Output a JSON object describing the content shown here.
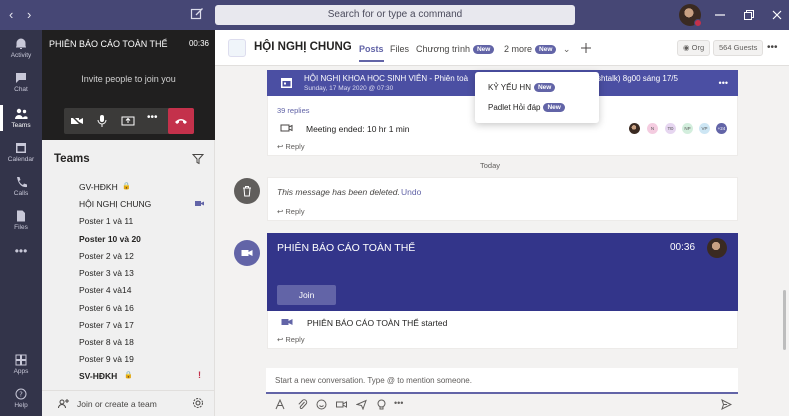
{
  "titlebar": {
    "search_placeholder": "Search for or type a command",
    "back": "‹",
    "forward": "›"
  },
  "rail": [
    {
      "label": "Activity",
      "icon": "bell-icon"
    },
    {
      "label": "Chat",
      "icon": "chat-icon"
    },
    {
      "label": "Teams",
      "icon": "teams-icon",
      "active": true
    },
    {
      "label": "Calendar",
      "icon": "calendar-icon"
    },
    {
      "label": "Calls",
      "icon": "phone-icon"
    },
    {
      "label": "Files",
      "icon": "file-icon"
    },
    {
      "label": "Apps",
      "icon": "apps-icon"
    },
    {
      "label": "Help",
      "icon": "help-icon"
    }
  ],
  "meeting": {
    "title": "PHIÊN BÁO CÁO TOÀN THỂ",
    "time": "00:36",
    "invite": "Invite people to join you"
  },
  "teams": {
    "heading": "Teams",
    "channels": [
      {
        "name": "GV-HĐKH",
        "lock": true
      },
      {
        "name": "HỘI NGHỊ CHUNG",
        "live": true
      },
      {
        "name": "Poster 1 và 11"
      },
      {
        "name": "Poster 10 và 20",
        "bold": true
      },
      {
        "name": "Poster 2 và 12"
      },
      {
        "name": "Poster 3 và 13"
      },
      {
        "name": "Poster 4 và14"
      },
      {
        "name": "Poster 6 và 16"
      },
      {
        "name": "Poster 7 và 17"
      },
      {
        "name": "Poster 8 và 18"
      },
      {
        "name": "Poster 9 và 19"
      },
      {
        "name": "SV-HĐKH",
        "bold": true,
        "lock": true,
        "alert": "!"
      }
    ],
    "join_label": "Join or create a team"
  },
  "header": {
    "team_name": "HỘI NGHỊ CHUNG",
    "tabs": [
      "Posts",
      "Files",
      "Chương trình",
      "2 more"
    ],
    "badge_new": "New",
    "org": "Org",
    "guests": "564 Guests"
  },
  "dropdown": {
    "items": [
      "KỶ YẾU HN",
      "Padlet Hỏi đáp"
    ]
  },
  "conversation": {
    "meeting_title": "HỘI NGHỊ KHOA HỌC SINH VIÊN - Phiên toà",
    "meeting_title_tail": "shtalk) 8g00 sáng 17/5",
    "meeting_date": "Sunday, 17 May 2020 @ 07:30",
    "replies": "39 replies",
    "meeting_ended": "Meeting ended: 10 hr 1 min",
    "participants": [
      "N",
      "TĐ",
      "NP",
      "VP"
    ],
    "participants_more": "+24",
    "reply": "Reply",
    "today": "Today",
    "deleted": "This message has been deleted.",
    "undo": "Undo",
    "live_title": "PHIÊN BÁO CÁO TOÀN THỂ",
    "live_time": "00:36",
    "join": "Join",
    "started": "PHIÊN BÁO CÁO TOÀN THỂ started",
    "compose_placeholder": "Start a new conversation. Type @ to mention someone."
  },
  "colors": {
    "accent": "#6264a7",
    "titlebar": "#464775",
    "rail": "#33344a",
    "meeting_bar": "#4b4fa3",
    "live_card": "#33358a",
    "hangup": "#c4314b"
  }
}
